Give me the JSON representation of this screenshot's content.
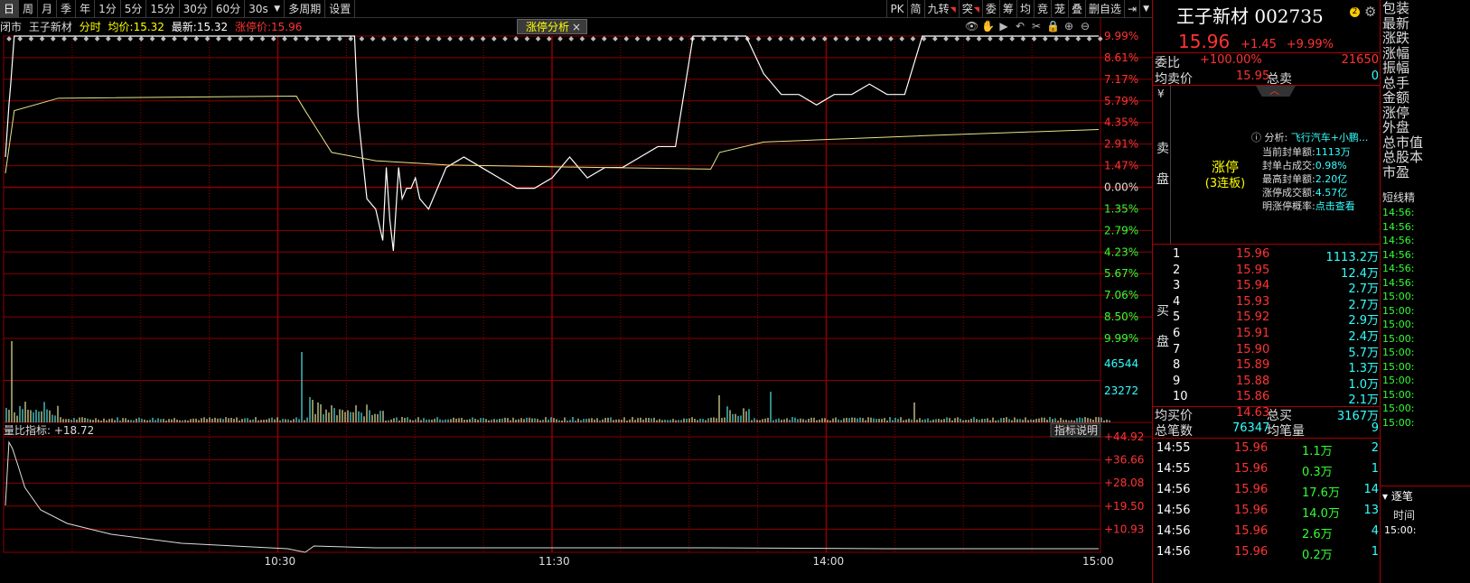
{
  "toolbar": {
    "periods": [
      "日",
      "周",
      "月",
      "季",
      "年",
      "1分",
      "5分",
      "15分",
      "30分",
      "60分"
    ],
    "interval": "30s",
    "multi_period": "多周期",
    "settings": "设置",
    "right_buttons": [
      {
        "label": "PK",
        "mark": false
      },
      {
        "label": "简",
        "mark": false
      },
      {
        "label": "九转",
        "mark": true
      },
      {
        "label": "突",
        "mark": true
      },
      {
        "label": "委",
        "mark": false
      },
      {
        "label": "筹",
        "mark": false
      },
      {
        "label": "均",
        "mark": false
      },
      {
        "label": "竞",
        "mark": false
      },
      {
        "label": "茏",
        "mark": false
      },
      {
        "label": "叠",
        "mark": false
      },
      {
        "label": "删自选",
        "mark": false
      }
    ]
  },
  "info_bar": {
    "status": "闭市",
    "name": "王子新材",
    "mode": "分时",
    "avg_label": "均价:",
    "avg_value": "15.32",
    "latest_label": "最新:",
    "latest_value": "15.32",
    "limit_label": "涨停价:",
    "limit_value": "15.96"
  },
  "analysis_tab": {
    "label": "涨停分析",
    "close": "×"
  },
  "price_axis_right": [
    "9.99%",
    "8.61%",
    "7.17%",
    "5.79%",
    "4.35%",
    "2.91%",
    "1.47%",
    "0.00%",
    "1.35%",
    "2.79%",
    "4.23%",
    "5.67%",
    "7.06%",
    "8.50%",
    "9.99%"
  ],
  "volume_axis_right": [
    "46544",
    "23272"
  ],
  "indicator": {
    "label": "量比指标: +18.72",
    "explain": "指标说明",
    "axis": [
      "+44.92",
      "+36.66",
      "+28.08",
      "+19.50",
      "+10.93"
    ]
  },
  "time_axis": [
    "10:30",
    "11:30",
    "14:00",
    "15:00"
  ],
  "colors": {
    "price_line": "#ffffff",
    "avg_line": "#e6e68a",
    "grid": "#8c0000",
    "volume": "#e6e6a0",
    "volume_alt": "#55e6e6"
  },
  "chart_data": {
    "type": "line",
    "title": "",
    "prev_close": 14.51,
    "limit_up": 15.96,
    "x": [
      0,
      2,
      4,
      6,
      10,
      20,
      40,
      60,
      80,
      110,
      140,
      150,
      160,
      168,
      172,
      178,
      180,
      185,
      190,
      195,
      200,
      210,
      215,
      220,
      225,
      230,
      238,
      245,
      250,
      255,
      260,
      265,
      270,
      280,
      290,
      300,
      308,
      316,
      326,
      336,
      346,
      356,
      370,
      380,
      390,
      396,
      400,
      405,
      410,
      420,
      428,
      432,
      436,
      440,
      446,
      450,
      455,
      460,
      465,
      470,
      480,
      500,
      520,
      540,
      560,
      580,
      600,
      620,
      640,
      660,
      680,
      700,
      720,
      740,
      760,
      780,
      800,
      820,
      840,
      860,
      880,
      900,
      920,
      940,
      960,
      980,
      1000,
      1020,
      1040,
      1060,
      1080,
      1100,
      1120,
      1140,
      1160,
      1180,
      1200,
      1220,
      1240
    ],
    "series": [
      {
        "values": [
          14.8,
          15.05,
          15.3,
          15.5,
          15.96,
          15.96,
          15.96,
          15.96,
          15.96,
          15.96,
          15.96,
          15.96,
          15.96,
          15.96,
          15.96,
          15.96,
          15.96,
          15.96,
          15.96,
          15.96,
          15.96,
          15.96,
          15.96,
          15.96,
          15.96,
          15.96,
          15.96,
          15.96,
          15.96,
          15.96,
          15.96,
          15.96,
          15.96,
          15.96,
          15.96,
          15.96,
          15.96,
          15.96,
          15.96,
          15.96,
          15.96,
          15.96,
          15.96,
          15.96,
          15.96,
          15.96,
          15.2,
          14.8,
          14.4,
          14.3,
          14.0,
          14.7,
          14.2,
          13.9,
          14.7,
          14.4,
          14.5,
          14.5,
          14.6,
          14.4,
          14.3,
          14.7,
          14.8,
          14.7,
          14.6,
          14.5,
          14.5,
          14.6,
          14.8,
          14.6,
          14.7,
          14.7,
          14.8,
          14.9,
          14.9,
          15.96,
          15.96,
          15.96,
          15.96,
          15.6,
          15.4,
          15.4,
          15.3,
          15.4,
          15.4,
          15.5,
          15.4,
          15.4,
          15.96,
          15.96,
          15.96,
          15.96,
          15.96,
          15.96,
          15.96,
          15.96,
          15.96,
          15.96,
          15.96
        ]
      }
    ]
  },
  "right_panel": {
    "stock_name": "王子新材 002735",
    "help_icon": "2",
    "price": "15.96",
    "change": "+1.45",
    "change_pct": "+9.99%",
    "weibi_label": "委比",
    "weibi_value": "+100.00%",
    "weicha_value": "21650",
    "avg_sell_label": "均卖价",
    "avg_sell_value": "15.95",
    "total_sell_label": "总卖",
    "total_sell_value": "0",
    "yen": "¥",
    "sell_label": [
      "卖",
      "盘"
    ],
    "seal_title": "涨停",
    "seal_sub": "(3连板)",
    "analysis": {
      "label": "分析:",
      "value": "飞行汽车+小鹏...",
      "rows": [
        {
          "k": "当前封单额:",
          "v": "1113万"
        },
        {
          "k": "封单占成交:",
          "v": "0.98%"
        },
        {
          "k": "最高封单额:",
          "v": "2.20亿"
        },
        {
          "k": "涨停成交额:",
          "v": "4.57亿"
        },
        {
          "k": "明涨停概率:",
          "v": "点击查看"
        }
      ]
    },
    "buy_label": [
      "买",
      "盘"
    ],
    "order_book": [
      {
        "n": "1",
        "p": "15.96",
        "v": "1113.2万"
      },
      {
        "n": "2",
        "p": "15.95",
        "v": "12.4万"
      },
      {
        "n": "3",
        "p": "15.94",
        "v": "2.7万"
      },
      {
        "n": "4",
        "p": "15.93",
        "v": "2.7万"
      },
      {
        "n": "5",
        "p": "15.92",
        "v": "2.9万"
      },
      {
        "n": "6",
        "p": "15.91",
        "v": "2.4万"
      },
      {
        "n": "7",
        "p": "15.90",
        "v": "5.7万"
      },
      {
        "n": "8",
        "p": "15.89",
        "v": "1.3万"
      },
      {
        "n": "9",
        "p": "15.88",
        "v": "1.0万"
      },
      {
        "n": "10",
        "p": "15.86",
        "v": "2.1万"
      }
    ],
    "avg_buy_label": "均买价",
    "avg_buy_value": "14.63",
    "total_buy_label": "总买",
    "total_buy_value": "3167万",
    "total_deals_label": "总笔数",
    "total_deals_value": "76347",
    "avg_volume_label": "均笔量",
    "avg_volume_value": "9",
    "ticks": [
      {
        "t": "14:55",
        "p": "15.96",
        "v": "1.1万",
        "c": "2"
      },
      {
        "t": "14:55",
        "p": "15.96",
        "v": "0.3万",
        "c": "1"
      },
      {
        "t": "14:56",
        "p": "15.96",
        "v": "17.6万",
        "c": "14"
      },
      {
        "t": "14:56",
        "p": "15.96",
        "v": "14.0万",
        "c": "13"
      },
      {
        "t": "14:56",
        "p": "15.96",
        "v": "2.6万",
        "c": "4"
      },
      {
        "t": "14:56",
        "p": "15.96",
        "v": "0.2万",
        "c": "1"
      }
    ]
  },
  "far_panel": {
    "labels": [
      "包装",
      "最新",
      "涨跌",
      "涨幅",
      "振幅",
      "总手",
      "金额",
      "涨停",
      "外盘",
      "总市值",
      "总股本",
      "市盈"
    ],
    "short_line": "短线精",
    "times": [
      "14:56:",
      "14:56:",
      "14:56:",
      "14:56:",
      "14:56:",
      "14:56:",
      "15:00:",
      "15:00:",
      "15:00:",
      "15:00:",
      "15:00:",
      "15:00:",
      "15:00:",
      "15:00:",
      "15:00:",
      "15:00:"
    ],
    "tab": "逐笔",
    "time_header": "时间",
    "bottom_time": "15:00:"
  }
}
